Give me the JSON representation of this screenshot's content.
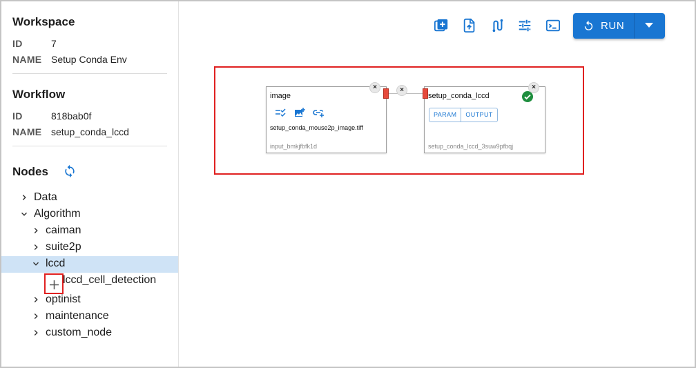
{
  "workspace": {
    "title": "Workspace",
    "id_label": "ID",
    "id_value": "7",
    "name_label": "NAME",
    "name_value": "Setup Conda Env"
  },
  "workflow": {
    "title": "Workflow",
    "id_label": "ID",
    "id_value": "818bab0f",
    "name_label": "NAME",
    "name_value": "setup_conda_lccd"
  },
  "nodes": {
    "title": "Nodes",
    "tree": {
      "data": "Data",
      "algorithm": "Algorithm",
      "caiman": "caiman",
      "suite2p": "suite2p",
      "lccd": "lccd",
      "lccd_cell_detection": "lccd_cell_detection",
      "optinist": "optinist",
      "maintenance": "maintenance",
      "custom_node": "custom_node"
    }
  },
  "toolbar": {
    "icons": [
      "add-box-icon",
      "upload-file-icon",
      "workflow-route-icon",
      "tune-icon",
      "terminal-icon"
    ],
    "run_label": "RUN"
  },
  "canvas": {
    "input_node": {
      "title": "image",
      "file": "setup_conda_mouse2p_image.tiff",
      "node_id": "input_bmkjfbfk1d"
    },
    "algo_node": {
      "title": "setup_conda_lccd",
      "param_label": "PARAM",
      "output_label": "OUTPUT",
      "node_id": "setup_conda_lccd_3suw9pfbqj"
    },
    "close_glyph": "×"
  },
  "colors": {
    "accent": "#1976d2",
    "highlight": "#e02020",
    "success": "#1e8e3e",
    "handle": "#e64a3c",
    "selected_row": "#cfe3f6"
  }
}
